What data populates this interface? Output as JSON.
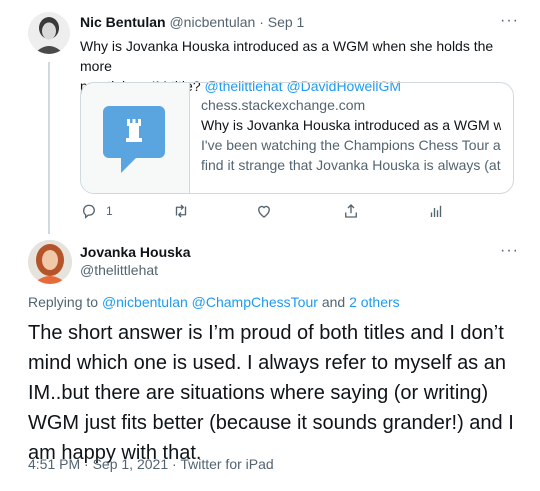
{
  "tweet1": {
    "display_name": "Nic Bentulan",
    "handle": "@nicbentulan",
    "separator": "·",
    "date": "Sep 1",
    "text_line1": "Why is Jovanka Houska introduced as a WGM when she holds the more",
    "text_line2": "prestigious IM title?",
    "mention1": "@thelittlehat",
    "mention2": "@DavidHowellGM",
    "card": {
      "domain": "chess.stackexchange.com",
      "title": "Why is Jovanka Houska introduced as a WGM whe...",
      "desc_line1": "I've been watching the Champions Chess Tour and",
      "desc_line2": "find it strange that Jovanka Houska is always (at ..."
    },
    "actions": {
      "reply_count": "1"
    }
  },
  "tweet2": {
    "display_name": "Jovanka Houska",
    "handle": "@thelittlehat",
    "replying_prefix": "Replying to",
    "replying_to1": "@nicbentulan",
    "replying_to2": "@ChampChessTour",
    "replying_and": "and",
    "replying_others": "2 others",
    "body_lines": [
      "The short answer is I’m proud of both titles and I don’t",
      "mind which one is used. I always refer to myself as an",
      "IM..but there are situations where saying (or writing)",
      "WGM just fits better (because it sounds grander!) and I",
      "am happy with that."
    ],
    "time": "4:51 PM",
    "date": "Sep 1, 2021",
    "separator": "·",
    "client": "Twitter for iPad"
  },
  "more_label": "···",
  "icons": {
    "reply": "reply-icon",
    "retweet": "retweet-icon",
    "like": "heart-icon",
    "share": "share-icon",
    "analytics": "analytics-icon",
    "more": "more-icon",
    "link_thumb": "chess-rook-icon"
  },
  "colors": {
    "link": "#1d9bf0",
    "muted": "#536471",
    "text": "#0f1419",
    "border": "#cfd9de",
    "thumb_blue": "#5aa4e0"
  }
}
